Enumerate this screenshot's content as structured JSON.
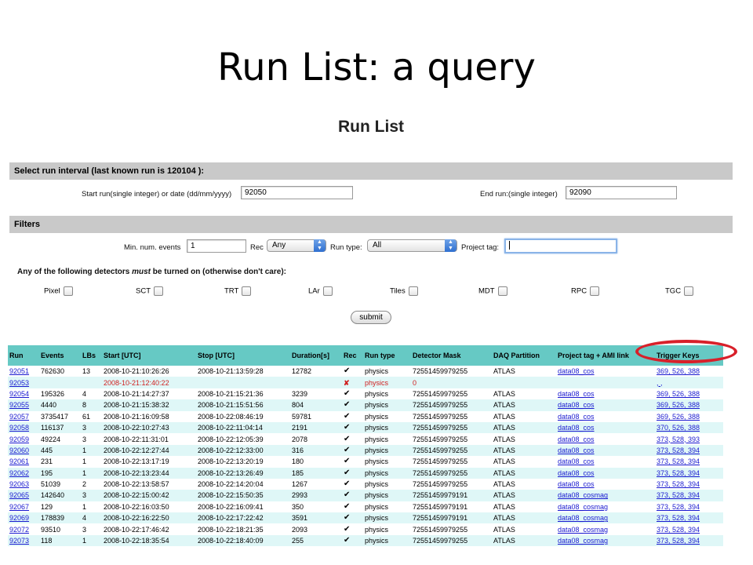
{
  "slide": {
    "title": "Run List: a query",
    "page_number": ""
  },
  "app": {
    "title": "Run List"
  },
  "run_interval": {
    "header": "Select run interval (last known run is 120104 ):",
    "start_label": "Start run(single integer) or date (dd/mm/yyyy)",
    "start_value": "92050",
    "end_label": "End run:(single integer)",
    "end_value": "92090"
  },
  "filters": {
    "header": "Filters",
    "min_events_label": "Min. num. events",
    "min_events_value": "1",
    "rec_label": "Rec",
    "rec_value": "Any",
    "run_type_label": "Run type:",
    "run_type_value": "All",
    "project_tag_label": "Project tag:",
    "project_tag_value": ""
  },
  "detectors": {
    "prompt_before": "Any of the following detectors ",
    "prompt_emph": "must",
    "prompt_after": " be turned on (otherwise don't care):",
    "items": [
      "Pixel",
      "SCT",
      "TRT",
      "LAr",
      "Tiles",
      "MDT",
      "RPC",
      "TGC"
    ]
  },
  "submit_label": "submit",
  "table": {
    "headers": [
      "Run",
      "Events",
      "LBs",
      "Start [UTC]",
      "Stop [UTC]",
      "Duration[s]",
      "Rec",
      "Run type",
      "Detector Mask",
      "DAQ Partition",
      "Project tag + AMI link",
      "Trigger Keys"
    ],
    "rows": [
      [
        "92051",
        "762630",
        "13",
        "2008-10-21:10:26:26",
        "2008-10-21:13:59:28",
        "12782",
        "✔",
        "physics",
        "72551459979255",
        "ATLAS",
        "data08_cos",
        "369, 526, 388"
      ],
      [
        "92053",
        "",
        "",
        "2008-10-21:12:40:22",
        "",
        "",
        "✘",
        "physics",
        "0",
        "",
        "",
        ", ,"
      ],
      [
        "92054",
        "195326",
        "4",
        "2008-10-21:14:27:37",
        "2008-10-21:15:21:36",
        "3239",
        "✔",
        "physics",
        "72551459979255",
        "ATLAS",
        "data08_cos",
        "369, 526, 388"
      ],
      [
        "92055",
        "4440",
        "8",
        "2008-10-21:15:38:32",
        "2008-10-21:15:51:56",
        "804",
        "✔",
        "physics",
        "72551459979255",
        "ATLAS",
        "data08_cos",
        "369, 526, 388"
      ],
      [
        "92057",
        "3735417",
        "61",
        "2008-10-21:16:09:58",
        "2008-10-22:08:46:19",
        "59781",
        "✔",
        "physics",
        "72551459979255",
        "ATLAS",
        "data08_cos",
        "369, 526, 388"
      ],
      [
        "92058",
        "116137",
        "3",
        "2008-10-22:10:27:43",
        "2008-10-22:11:04:14",
        "2191",
        "✔",
        "physics",
        "72551459979255",
        "ATLAS",
        "data08_cos",
        "370, 526, 388"
      ],
      [
        "92059",
        "49224",
        "3",
        "2008-10-22:11:31:01",
        "2008-10-22:12:05:39",
        "2078",
        "✔",
        "physics",
        "72551459979255",
        "ATLAS",
        "data08_cos",
        "373, 528, 393"
      ],
      [
        "92060",
        "445",
        "1",
        "2008-10-22:12:27:44",
        "2008-10-22:12:33:00",
        "316",
        "✔",
        "physics",
        "72551459979255",
        "ATLAS",
        "data08_cos",
        "373, 528, 394"
      ],
      [
        "92061",
        "231",
        "1",
        "2008-10-22:13:17:19",
        "2008-10-22:13:20:19",
        "180",
        "✔",
        "physics",
        "72551459979255",
        "ATLAS",
        "data08_cos",
        "373, 528, 394"
      ],
      [
        "92062",
        "195",
        "1",
        "2008-10-22:13:23:44",
        "2008-10-22:13:26:49",
        "185",
        "✔",
        "physics",
        "72551459979255",
        "ATLAS",
        "data08_cos",
        "373, 528, 394"
      ],
      [
        "92063",
        "51039",
        "2",
        "2008-10-22:13:58:57",
        "2008-10-22:14:20:04",
        "1267",
        "✔",
        "physics",
        "72551459979255",
        "ATLAS",
        "data08_cos",
        "373, 528, 394"
      ],
      [
        "92065",
        "142640",
        "3",
        "2008-10-22:15:00:42",
        "2008-10-22:15:50:35",
        "2993",
        "✔",
        "physics",
        "72551459979191",
        "ATLAS",
        "data08_cosmag",
        "373, 528, 394"
      ],
      [
        "92067",
        "129",
        "1",
        "2008-10-22:16:03:50",
        "2008-10-22:16:09:41",
        "350",
        "✔",
        "physics",
        "72551459979191",
        "ATLAS",
        "data08_cosmag",
        "373, 528, 394"
      ],
      [
        "92069",
        "178839",
        "4",
        "2008-10-22:16:22:50",
        "2008-10-22:17:22:42",
        "3591",
        "✔",
        "physics",
        "72551459979191",
        "ATLAS",
        "data08_cosmag",
        "373, 528, 394"
      ],
      [
        "92072",
        "93510",
        "3",
        "2008-10-22:17:46:42",
        "2008-10-22:18:21:35",
        "2093",
        "✔",
        "physics",
        "72551459979255",
        "ATLAS",
        "data08_cosmag",
        "373, 528, 394"
      ],
      [
        "92073",
        "118",
        "1",
        "2008-10-22:18:35:54",
        "2008-10-22:18:40:09",
        "255",
        "✔",
        "physics",
        "72551459979255",
        "ATLAS",
        "data08_cosmag",
        "373, 528, 394"
      ]
    ]
  },
  "colors": {
    "table_header": "#66c9c4",
    "row_alt": "#dff7f7",
    "link": "#1a1ad0",
    "error": "#d02020",
    "highlight": "#d8202a"
  }
}
